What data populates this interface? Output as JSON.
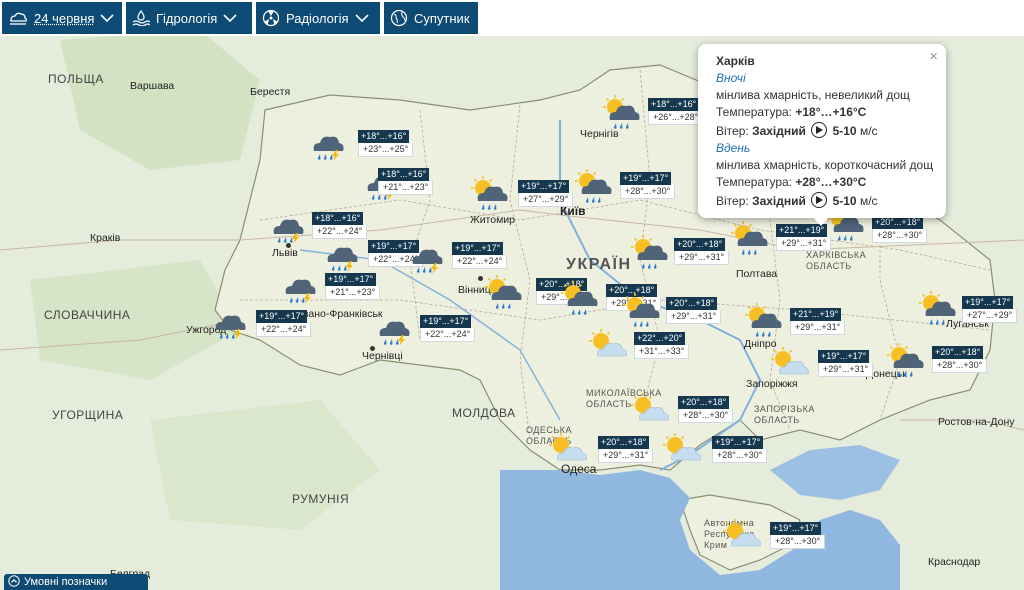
{
  "toolbar": {
    "date": "24 червня",
    "hydrology": "Гідрологія",
    "radiology": "Радіологія",
    "satellite": "Супутник"
  },
  "map_labels": {
    "poland": "ПОЛЬЩА",
    "slovakia": "СЛОВАЧЧИНА",
    "hungary": "УГОРЩИНА",
    "romania": "РУМУНІЯ",
    "moldova": "МОЛДОВА",
    "ukraine": "УКРАЇН",
    "kharkiv_obl": "ХАРКІВСЬКА ОБЛАСТЬ",
    "luhansk": "Луганськ",
    "zaporizhzhia_obl": "ЗАПОРІЗЬКА ОБЛАСТЬ",
    "mykolaiv_obl": "МИКОЛАЇВСЬКА ОБЛАСТЬ",
    "odesa_obl": "ОДЕСЬКА ОБЛАСТЬ",
    "crimea": "Автономна Республіка Крим"
  },
  "cities": [
    {
      "name": "Варшава"
    },
    {
      "name": "Берестя"
    },
    {
      "name": "Краків"
    },
    {
      "name": "Львів"
    },
    {
      "name": "Ужгород"
    },
    {
      "name": "Івано-Франківськ"
    },
    {
      "name": "Чернівці"
    },
    {
      "name": "Житомир"
    },
    {
      "name": "Київ"
    },
    {
      "name": "Вінниця"
    },
    {
      "name": "Чернігів"
    },
    {
      "name": "Полтава"
    },
    {
      "name": "Дніпро"
    },
    {
      "name": "Запоріжжя"
    },
    {
      "name": "Донецьк"
    },
    {
      "name": "Одеса"
    },
    {
      "name": "Белград"
    },
    {
      "name": "Ростов-на-Дону"
    },
    {
      "name": "Краснодар"
    }
  ],
  "forecasts": [
    {
      "night": "+18°...+16°",
      "day": "+23°...+25°",
      "icon": "storm-rain-icon"
    },
    {
      "night": "+18°...+16°",
      "day": "+21°...+23°",
      "icon": "storm-rain-icon"
    },
    {
      "night": "+18°...+16°",
      "day": "+22°...+24°",
      "icon": "storm-rain-icon"
    },
    {
      "night": "+19°...+17°",
      "day": "+22°...+24°",
      "icon": "storm-rain-icon"
    },
    {
      "night": "+19°...+17°",
      "day": "+21°...+23°",
      "icon": "storm-rain-icon"
    },
    {
      "night": "+19°...+17°",
      "day": "+22°...+24°",
      "icon": "storm-rain-icon"
    },
    {
      "night": "+19°...+17°",
      "day": "+22°...+24°",
      "icon": "storm-rain-icon"
    },
    {
      "night": "+19°...+17°",
      "day": "+22°...+24°",
      "icon": "storm-rain-icon"
    },
    {
      "night": "+19°...+17°",
      "day": "+27°...+29°",
      "icon": "sun-cloud-rain-icon"
    },
    {
      "night": "+19°...+17°",
      "day": "+28°...+30°",
      "icon": "sun-cloud-rain-icon"
    },
    {
      "night": "+18°...+16°",
      "day": "+26°...+28°",
      "icon": "sun-cloud-rain-icon"
    },
    {
      "night": "+20°...+18°",
      "day": "+29°...+31°",
      "icon": "sun-cloud-rain-icon"
    },
    {
      "night": "+20°...+18°",
      "day": "+29°...+31°",
      "icon": "sun-cloud-rain-icon"
    },
    {
      "night": "+20°...+18°",
      "day": "+29°...+31°",
      "icon": "sun-cloud-rain-icon"
    },
    {
      "night": "+20°...+18°",
      "day": "+29°...+31°",
      "icon": "sun-cloud-rain-icon"
    },
    {
      "night": "+21°...+19°",
      "day": "+29°...+31°",
      "icon": "sun-cloud-rain-icon"
    },
    {
      "night": "+21°...+19°",
      "day": "+29°...+31°",
      "icon": "sun-cloud-rain-icon"
    },
    {
      "night": "+22°...+20°",
      "day": "+31°...+33°",
      "icon": "sun-cloud-icon"
    },
    {
      "night": "+19°...+17°",
      "day": "+29°...+31°",
      "icon": "sun-cloud-icon"
    },
    {
      "night": "+19°...+17°",
      "day": "+27°...+29°",
      "icon": "sun-cloud-rain-icon"
    },
    {
      "night": "+20°...+18°",
      "day": "+28°...+30°",
      "icon": "sun-cloud-rain-icon"
    },
    {
      "night": "+20°...+18°",
      "day": "+28°...+30°",
      "icon": "sun-cloud-icon"
    },
    {
      "night": "+20°...+18°",
      "day": "+29°...+31°",
      "icon": "sun-cloud-icon"
    },
    {
      "night": "+19°...+17°",
      "day": "+28°...+30°",
      "icon": "sun-cloud-icon"
    },
    {
      "night": "+19°...+17°",
      "day": "+28°...+30°",
      "icon": "sun-cloud-icon"
    },
    {
      "night": "+20°...+18°",
      "day": "+28°...+30°",
      "icon": "sun-cloud-rain-icon"
    }
  ],
  "popup": {
    "city": "Харків",
    "night_label": "Вночі",
    "night_desc": "мінлива хмарність, невеликий дощ",
    "temp_label": "Температура:",
    "night_temp": "+18°…+16°C",
    "wind_label": "Вітер:",
    "wind_dir": "Західний",
    "night_wind": "5-10",
    "wind_unit": "м/с",
    "day_label": "Вдень",
    "day_desc": "мінлива хмарність, короткочасний дощ",
    "day_temp": "+28°…+30°C",
    "day_wind": "5-10",
    "close": "×"
  },
  "legend": {
    "label": "Умовні позначки"
  },
  "colors": {
    "toolbar": "#0e4b74",
    "sea": "#8fb7df",
    "land": "#dfe9d8",
    "ukraine": "#eef0df",
    "badge": "#15384f"
  }
}
